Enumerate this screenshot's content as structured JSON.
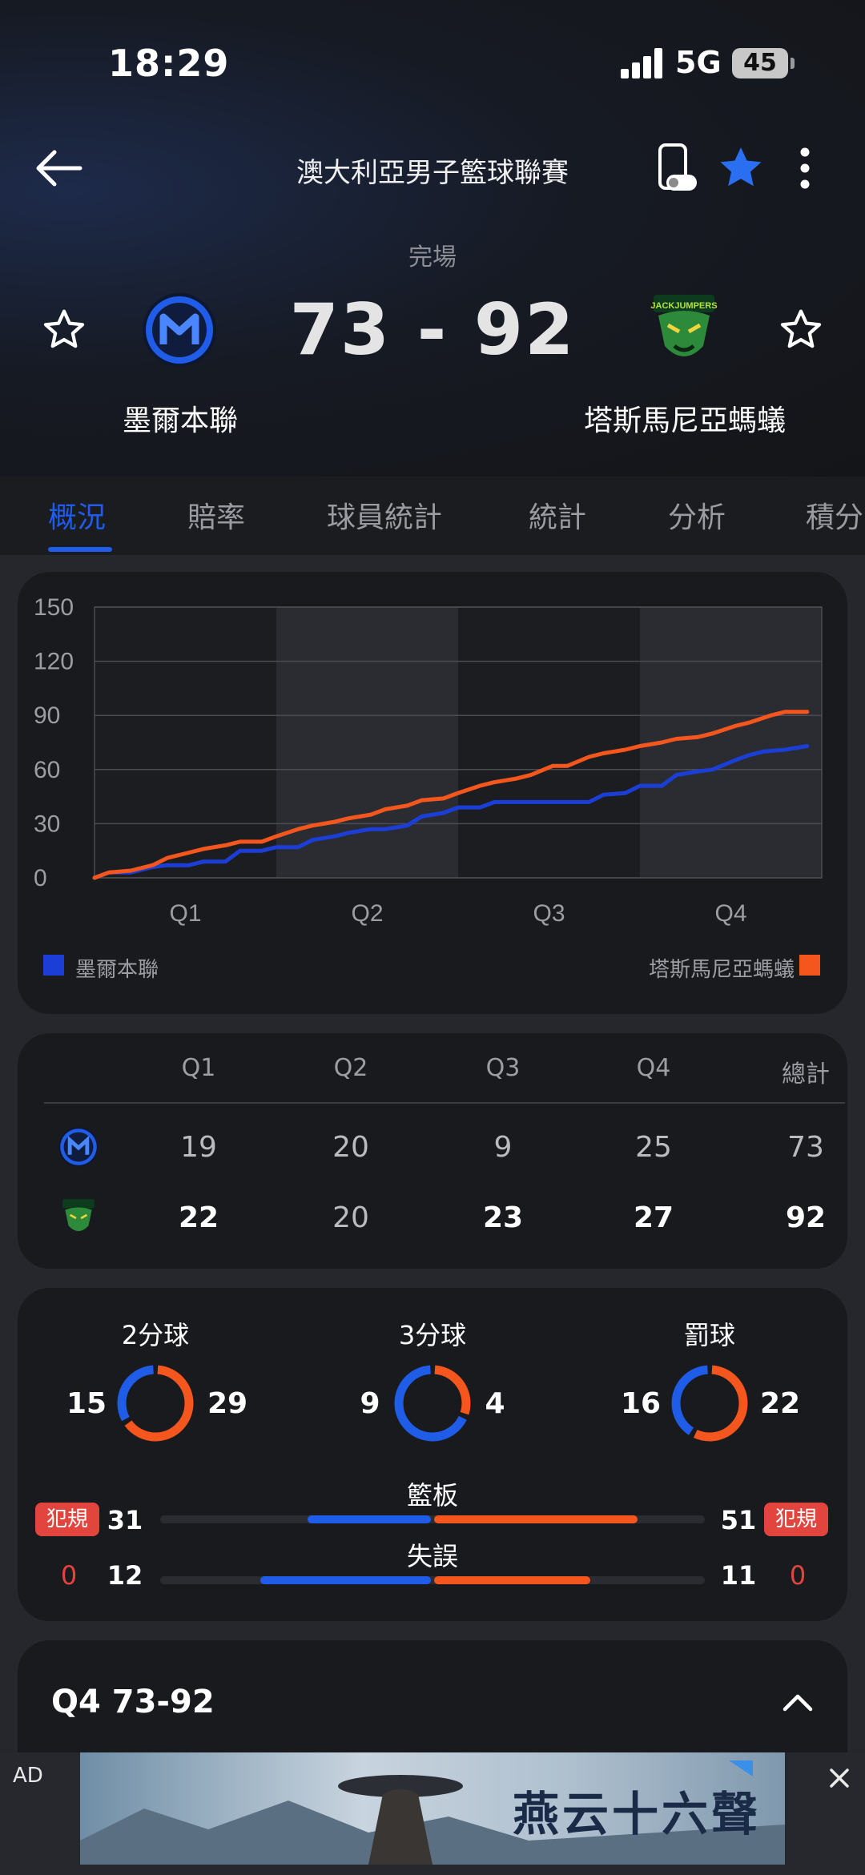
{
  "status_bar": {
    "time": "18:29",
    "network": "5G",
    "battery": "45"
  },
  "header": {
    "title": "澳大利亞男子籃球聯賽"
  },
  "match": {
    "status": "完場",
    "score": "73 - 92",
    "home": {
      "name": "墨爾本聯",
      "color": "#1f5ce8"
    },
    "away": {
      "name": "塔斯馬尼亞螞蟻",
      "logo_text": "JACKJUMPERS",
      "color": "#f5561d"
    }
  },
  "tabs": [
    {
      "label": "概況",
      "active": true
    },
    {
      "label": "賠率"
    },
    {
      "label": "球員統計"
    },
    {
      "label": "統計"
    },
    {
      "label": "分析"
    },
    {
      "label": "積分"
    }
  ],
  "chart_data": {
    "type": "line",
    "x_categories": [
      "Q1",
      "Q2",
      "Q3",
      "Q4"
    ],
    "y_ticks": [
      "150",
      "120",
      "90",
      "60",
      "30",
      "0"
    ],
    "ylim": [
      0,
      150
    ],
    "grid": true,
    "legend": {
      "left": "墨爾本聯",
      "right": "塔斯馬尼亞螞蟻"
    },
    "series": [
      {
        "name": "墨爾本聯",
        "color": "#1b3fd6",
        "points": [
          [
            0,
            0
          ],
          [
            2,
            3
          ],
          [
            5,
            3
          ],
          [
            8,
            6
          ],
          [
            10,
            7
          ],
          [
            13,
            7
          ],
          [
            15,
            9
          ],
          [
            18,
            9
          ],
          [
            20,
            15
          ],
          [
            23,
            15
          ],
          [
            25,
            17
          ],
          [
            28,
            17
          ],
          [
            30,
            21
          ],
          [
            33,
            23
          ],
          [
            35,
            25
          ],
          [
            38,
            27
          ],
          [
            40,
            27
          ],
          [
            43,
            29
          ],
          [
            45,
            34
          ],
          [
            48,
            36
          ],
          [
            50,
            39
          ],
          [
            53,
            39
          ],
          [
            55,
            42
          ],
          [
            58,
            42
          ],
          [
            60,
            42
          ],
          [
            63,
            42
          ],
          [
            65,
            42
          ],
          [
            68,
            42
          ],
          [
            70,
            46
          ],
          [
            73,
            47
          ],
          [
            75,
            51
          ],
          [
            78,
            51
          ],
          [
            80,
            57
          ],
          [
            83,
            59
          ],
          [
            85,
            60
          ],
          [
            88,
            65
          ],
          [
            90,
            68
          ],
          [
            92,
            70
          ],
          [
            95,
            71
          ],
          [
            98,
            73
          ]
        ]
      },
      {
        "name": "塔斯馬尼亞螞蟻",
        "color": "#f5561d",
        "points": [
          [
            0,
            0
          ],
          [
            2,
            3
          ],
          [
            5,
            4
          ],
          [
            8,
            7
          ],
          [
            10,
            11
          ],
          [
            13,
            14
          ],
          [
            15,
            16
          ],
          [
            18,
            18
          ],
          [
            20,
            20
          ],
          [
            23,
            20
          ],
          [
            25,
            23
          ],
          [
            28,
            27
          ],
          [
            30,
            29
          ],
          [
            33,
            31
          ],
          [
            35,
            33
          ],
          [
            38,
            35
          ],
          [
            40,
            38
          ],
          [
            43,
            40
          ],
          [
            45,
            43
          ],
          [
            48,
            44
          ],
          [
            50,
            47
          ],
          [
            53,
            51
          ],
          [
            55,
            53
          ],
          [
            58,
            55
          ],
          [
            60,
            57
          ],
          [
            63,
            62
          ],
          [
            65,
            62
          ],
          [
            68,
            67
          ],
          [
            70,
            69
          ],
          [
            73,
            71
          ],
          [
            75,
            73
          ],
          [
            78,
            75
          ],
          [
            80,
            77
          ],
          [
            83,
            78
          ],
          [
            85,
            80
          ],
          [
            88,
            84
          ],
          [
            90,
            86
          ],
          [
            93,
            90
          ],
          [
            95,
            92
          ],
          [
            98,
            92
          ]
        ]
      }
    ]
  },
  "quarter_table": {
    "headers": [
      "Q1",
      "Q2",
      "Q3",
      "Q4",
      "總計"
    ],
    "home": [
      "19",
      "20",
      "9",
      "25",
      "73"
    ],
    "away": [
      "22",
      "20",
      "23",
      "27",
      "92"
    ]
  },
  "shooting": [
    {
      "label": "2分球",
      "home": "15",
      "away": "29",
      "home_fraction": 0.34
    },
    {
      "label": "3分球",
      "home": "9",
      "away": "4",
      "home_fraction": 0.69
    },
    {
      "label": "罰球",
      "home": "16",
      "away": "22",
      "home_fraction": 0.42
    }
  ],
  "bars": [
    {
      "label": "籃板",
      "home": "31",
      "away": "51",
      "home_fraction": 0.38,
      "away_fraction": 0.62
    },
    {
      "label": "失誤",
      "home": "12",
      "away": "11",
      "home_fraction": 0.52,
      "away_fraction": 0.48
    }
  ],
  "fouls": {
    "label": "犯規",
    "home": "0",
    "away": "0"
  },
  "quarter_summary": "Q4 73-92",
  "ad": {
    "tag": "AD",
    "headline": "燕云十六聲"
  }
}
